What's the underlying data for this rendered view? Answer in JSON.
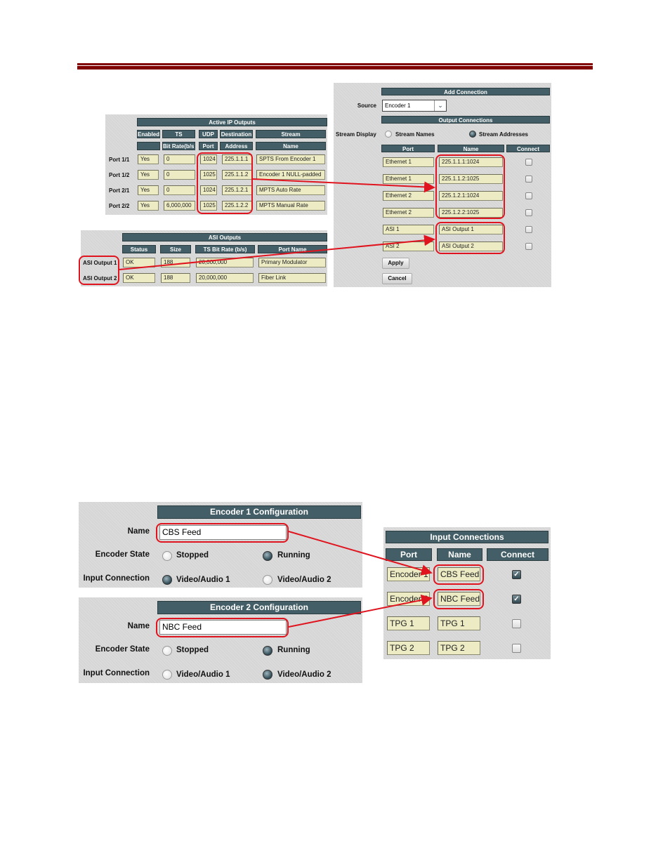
{
  "active_ip_outputs": {
    "title": "Active IP Outputs",
    "header_row1": [
      "Enabled",
      "TS",
      "UDP",
      "Destination",
      "Stream"
    ],
    "header_row2": [
      "",
      "Bit Rate(b/s)",
      "Port",
      "Address",
      "Name"
    ],
    "rows": [
      {
        "label": "Port 1/1",
        "enabled": "Yes",
        "bitrate": "0",
        "port": "1024",
        "address": "225.1.1.1",
        "name": "SPTS From Encoder 1"
      },
      {
        "label": "Port 1/2",
        "enabled": "Yes",
        "bitrate": "0",
        "port": "1025",
        "address": "225.1.1.2",
        "name": "Encoder 1 NULL-padded"
      },
      {
        "label": "Port 2/1",
        "enabled": "Yes",
        "bitrate": "0",
        "port": "1024",
        "address": "225.1.2.1",
        "name": "MPTS Auto Rate"
      },
      {
        "label": "Port 2/2",
        "enabled": "Yes",
        "bitrate": "6,000,000",
        "port": "1025",
        "address": "225.1.2.2",
        "name": "MPTS Manual Rate"
      }
    ]
  },
  "asi_outputs": {
    "title": "ASI Outputs",
    "headers": [
      "Status",
      "Size",
      "TS Bit Rate (b/s)",
      "Port Name"
    ],
    "rows": [
      {
        "label": "ASI Output 1",
        "status": "OK",
        "size": "188",
        "bitrate": "20,000,000",
        "port_name": "Primary Modulator"
      },
      {
        "label": "ASI Output 2",
        "status": "OK",
        "size": "188",
        "bitrate": "20,000,000",
        "port_name": "Fiber Link"
      }
    ]
  },
  "add_connection": {
    "title": "Add Connection",
    "source_label": "Source",
    "source_value": "Encoder 1",
    "output_title": "Output Connections",
    "stream_display_label": "Stream Display",
    "stream_display_options": [
      "Stream Names",
      "Stream Addresses"
    ],
    "stream_display_selected": "Stream Addresses",
    "headers": [
      "Port",
      "Name",
      "Connect"
    ],
    "rows": [
      {
        "port": "Ethernet 1",
        "name": "225.1.1.1:1024",
        "connected": false
      },
      {
        "port": "Ethernet 1",
        "name": "225.1.1.2:1025",
        "connected": false
      },
      {
        "port": "Ethernet 2",
        "name": "225.1.2.1:1024",
        "connected": false
      },
      {
        "port": "Ethernet 2",
        "name": "225.1.2.2:1025",
        "connected": false
      },
      {
        "port": "ASI 1",
        "name": "ASI Output 1",
        "connected": false
      },
      {
        "port": "ASI 2",
        "name": "ASI Output 2",
        "connected": false
      }
    ],
    "apply_label": "Apply",
    "cancel_label": "Cancel"
  },
  "encoder1": {
    "title": "Encoder 1 Configuration",
    "name_label": "Name",
    "name_value": "CBS Feed",
    "state_label": "Encoder State",
    "state_options": [
      "Stopped",
      "Running"
    ],
    "state_selected": "Running",
    "input_label": "Input Connection",
    "input_options": [
      "Video/Audio 1",
      "Video/Audio 2"
    ],
    "input_selected": "Video/Audio 1"
  },
  "encoder2": {
    "title": "Encoder 2 Configuration",
    "name_label": "Name",
    "name_value": "NBC Feed",
    "state_label": "Encoder State",
    "state_options": [
      "Stopped",
      "Running"
    ],
    "state_selected": "Running",
    "input_label": "Input Connection",
    "input_options": [
      "Video/Audio 1",
      "Video/Audio 2"
    ],
    "input_selected": "Video/Audio 2"
  },
  "input_connections": {
    "title": "Input Connections",
    "headers": [
      "Port",
      "Name",
      "Connect"
    ],
    "rows": [
      {
        "port": "Encoder 1",
        "name": "CBS Feed",
        "connected": true
      },
      {
        "port": "Encoder 2",
        "name": "NBC Feed",
        "connected": true
      },
      {
        "port": "TPG 1",
        "name": "TPG 1",
        "connected": false
      },
      {
        "port": "TPG 2",
        "name": "TPG 2",
        "connected": false
      }
    ]
  },
  "colors": {
    "header_bg": "#435e66",
    "field_bg": "#ecebc4",
    "highlight": "#e0141e",
    "rule": "#800000"
  }
}
